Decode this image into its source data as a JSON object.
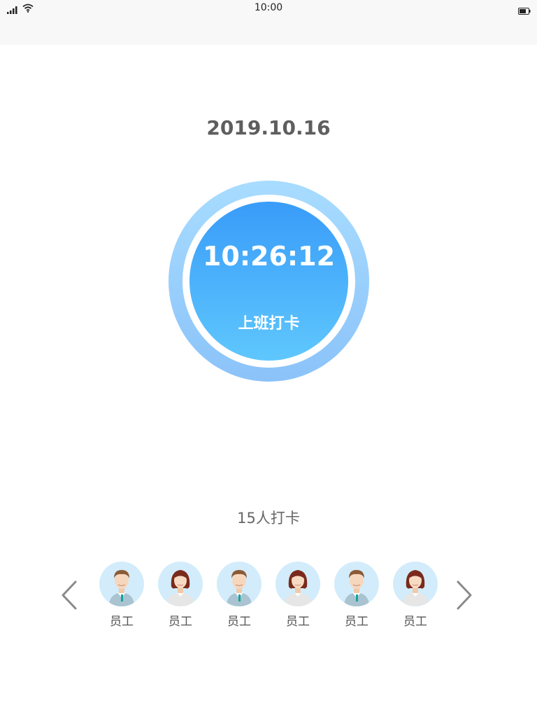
{
  "status_bar": {
    "time": "10:00",
    "signal_icon": "signal-icon",
    "wifi_icon": "wifi-icon",
    "battery_icon": "battery-icon"
  },
  "date": "2019.10.16",
  "clock": {
    "time": "10:26:12",
    "action_label": "上班打卡",
    "colors": {
      "ring_top": "#a8dcff",
      "ring_bottom": "#8bc3f9",
      "inner_top": "#399cf9",
      "inner_bottom": "#5fc7fd"
    }
  },
  "checkin_count_text": "15人打卡",
  "navigation": {
    "prev_icon": "chevron-left-icon",
    "next_icon": "chevron-right-icon"
  },
  "employees": [
    {
      "label": "员工",
      "avatar": "male"
    },
    {
      "label": "员工",
      "avatar": "female"
    },
    {
      "label": "员工",
      "avatar": "male"
    },
    {
      "label": "员工",
      "avatar": "female"
    },
    {
      "label": "员工",
      "avatar": "male"
    },
    {
      "label": "员工",
      "avatar": "female"
    }
  ]
}
